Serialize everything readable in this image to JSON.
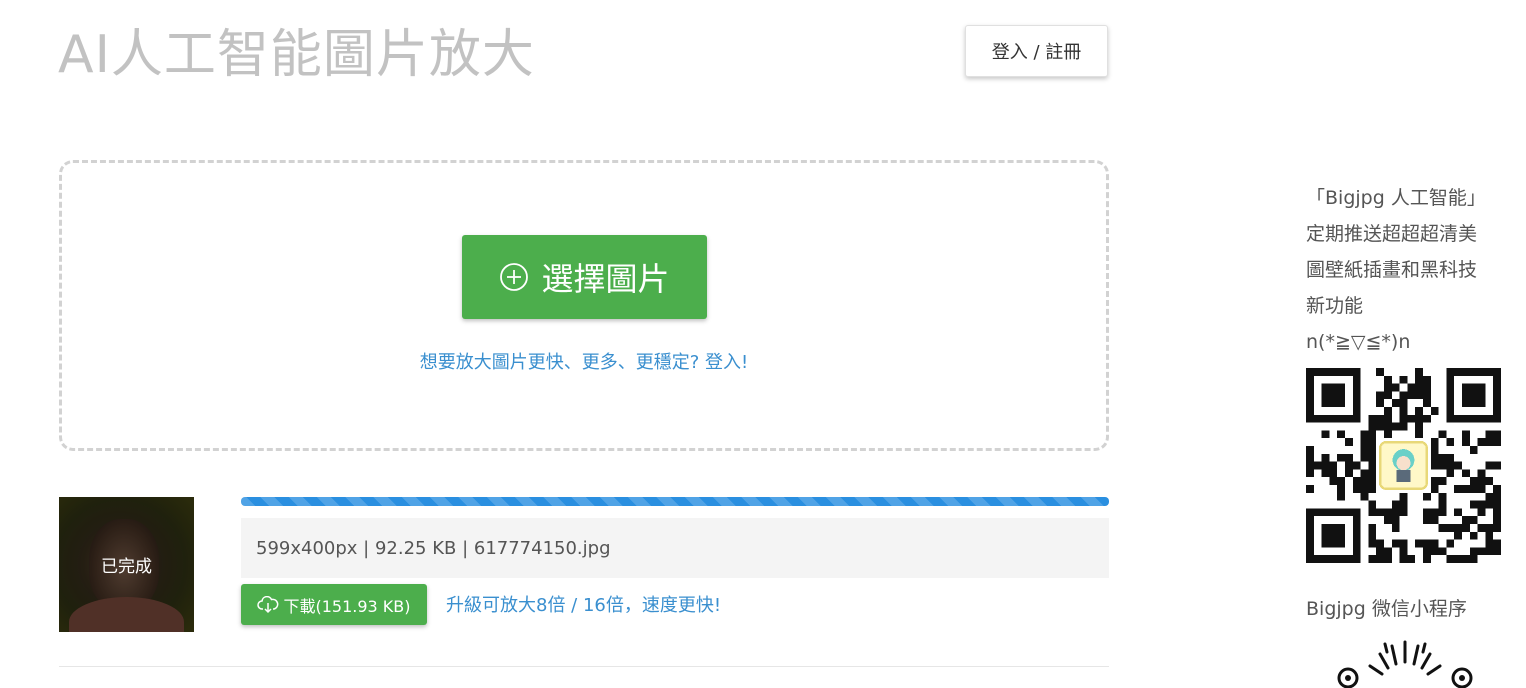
{
  "header": {
    "title": "AI人工智能圖片放大",
    "login_label": "登入 / 註冊"
  },
  "upload": {
    "select_label": "選擇圖片",
    "faster_link": "想要放大圖片更快、更多、更穩定? 登入!"
  },
  "task": {
    "status": "已完成",
    "progress_percent": 100,
    "file_info": "599x400px | 92.25 KB | 617774150.jpg",
    "download_label": "下載(151.93 KB)",
    "upgrade_link": "升級可放大8倍 / 16倍，速度更快!"
  },
  "sidebar": {
    "lines": [
      "「Bigjpg 人工智能」",
      "定期推送超超超清美",
      "圖壁紙插畫和黑科技",
      "新功能",
      "n(*≧▽≦*)n"
    ],
    "mini_program_label": "Bigjpg 微信小程序"
  },
  "colors": {
    "green": "#4cae4c",
    "link_blue": "#3a8fcf",
    "progress_blue": "#2a8fe0",
    "title_gray": "#c2c2c2"
  },
  "icons": {
    "select": "plus-circle-icon",
    "download": "cloud-download-icon"
  }
}
